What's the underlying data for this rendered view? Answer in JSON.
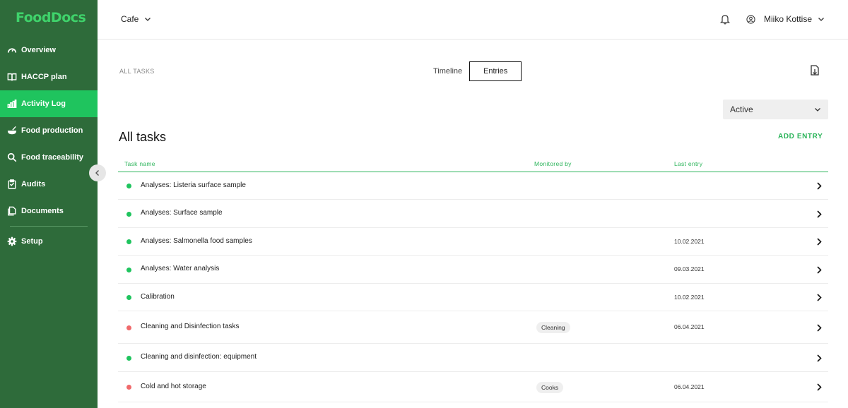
{
  "app": {
    "logo_text": "FoodDocs"
  },
  "sidebar": {
    "items": [
      {
        "label": "Overview",
        "icon": "gauge-icon",
        "active": false
      },
      {
        "label": "HACCP plan",
        "icon": "book-icon",
        "active": false
      },
      {
        "label": "Activity Log",
        "icon": "bar-chart-icon",
        "active": true
      },
      {
        "label": "Food production",
        "icon": "bowl-icon",
        "active": false
      },
      {
        "label": "Food traceability",
        "icon": "search-icon",
        "active": false
      },
      {
        "label": "Audits",
        "icon": "clipboard-icon",
        "active": false
      },
      {
        "label": "Documents",
        "icon": "documents-icon",
        "active": false
      }
    ],
    "setup_label": "Setup",
    "setup_icon": "gear-icon"
  },
  "header": {
    "location": "Cafe",
    "user_name": "Miiko Kottise"
  },
  "breadcrumb": "ALL TASKS",
  "view_toggle": {
    "timeline_label": "Timeline",
    "entries_label": "Entries"
  },
  "status_filter": {
    "selected": "Active"
  },
  "main": {
    "title": "All tasks",
    "add_entry_label": "ADD ENTRY"
  },
  "table": {
    "columns": [
      "Task name",
      "Monitored by",
      "Last entry"
    ],
    "rows": [
      {
        "name": "Analyses: Listeria surface sample",
        "status": "green",
        "monitored_by": "",
        "last_entry": ""
      },
      {
        "name": "Analyses: Surface sample",
        "status": "green",
        "monitored_by": "",
        "last_entry": ""
      },
      {
        "name": "Analyses: Salmonella food samples",
        "status": "green",
        "monitored_by": "",
        "last_entry": "10.02.2021"
      },
      {
        "name": "Analyses: Water analysis",
        "status": "green",
        "monitored_by": "",
        "last_entry": "09.03.2021"
      },
      {
        "name": "Calibration",
        "status": "green",
        "monitored_by": "",
        "last_entry": "10.02.2021"
      },
      {
        "name": "Cleaning and Disinfection tasks",
        "status": "red",
        "monitored_by": "Cleaning",
        "last_entry": "06.04.2021"
      },
      {
        "name": "Cleaning and disinfection: equipment",
        "status": "green",
        "monitored_by": "",
        "last_entry": ""
      },
      {
        "name": "Cold and hot storage",
        "status": "red",
        "monitored_by": "Cooks",
        "last_entry": "06.04.2021"
      }
    ]
  },
  "colors": {
    "sidebar_bg": "#2e6b3a",
    "active_item": "#1fc45e",
    "accent": "#2bb45a",
    "status_green": "#1fc45e",
    "status_red": "#f0696b"
  }
}
